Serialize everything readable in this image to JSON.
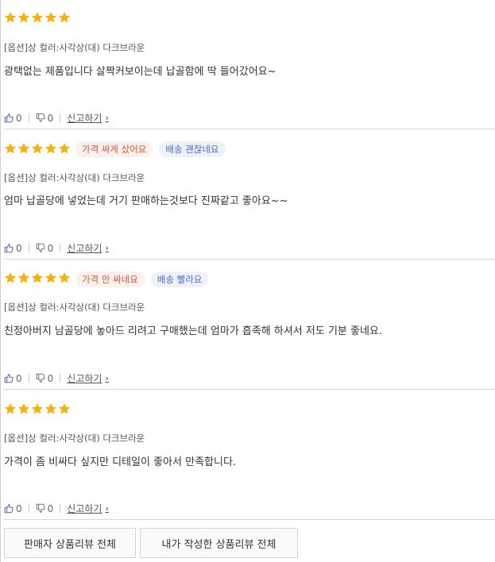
{
  "colors": {
    "star": "#f6b20a",
    "tag_price": "#e0542f",
    "tag_delivery": "#4a6fbf",
    "divider": "#d9d9d9"
  },
  "reviews": [
    {
      "rating": 5,
      "tags": [],
      "option": "[옵션]상 컬러:사각상(대) 다크브라운",
      "content": "광택없는 제품입니다 살짝커보이는데 납골함에 딱 들어갔어요~",
      "likes": "0",
      "dislikes": "0",
      "report": "신고하기"
    },
    {
      "rating": 5,
      "tags": [
        "가격 싸게 샀어요",
        "배송 괜찮네요"
      ],
      "option": "[옵션]상 컬러:사각상(대) 다크브라운",
      "content": "엄마 납골당에 넣었는데 거기 판매하는것보다 진짜같고 좋아요~~",
      "likes": "0",
      "dislikes": "0",
      "report": "신고하기"
    },
    {
      "rating": 5,
      "tags": [
        "가격 안 싸네요",
        "배송 빨라요"
      ],
      "option": "[옵션]상 컬러:사각상(대) 다크브라운",
      "content": "친정아버지 남골당에 놓아드 리려고 구매했는데 엄마가 흡족해 하셔서 저도 기분 좋네요.",
      "likes": "0",
      "dislikes": "0",
      "report": "신고하기"
    },
    {
      "rating": 5,
      "tags": [],
      "option": "[옵션]상 컬러:사각상(대) 다크브라운",
      "content": "가격이 좀 비싸다 싶지만 디테일이 좋아서 만족합니다.",
      "likes": "0",
      "dislikes": "0",
      "report": "신고하기"
    }
  ],
  "buttons": {
    "seller_reviews": "판매자 상품리뷰 전체",
    "my_reviews": "내가 작성한 상품리뷰 전체"
  }
}
